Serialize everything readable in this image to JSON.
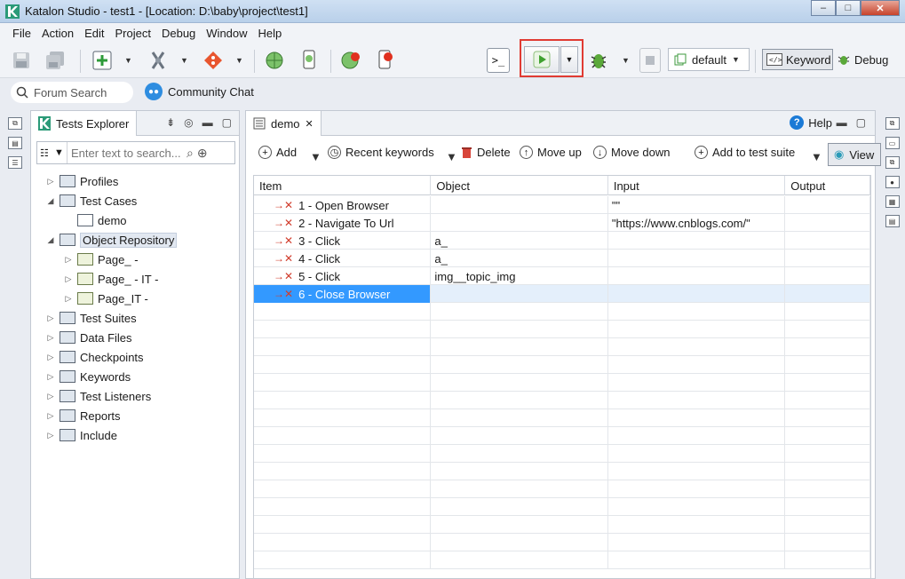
{
  "window": {
    "title": "Katalon Studio - test1 - [Location: D:\\baby\\project\\test1]",
    "controls": [
      "–",
      "□",
      "✕"
    ]
  },
  "menu": [
    "File",
    "Action",
    "Edit",
    "Project",
    "Debug",
    "Window",
    "Help"
  ],
  "toolbar": {
    "profile": "default",
    "keyword_label": "Keyword",
    "debug_label": "Debug"
  },
  "search": {
    "forum_placeholder": "Forum Search",
    "community_label": "Community Chat"
  },
  "explorer": {
    "tab_label": "Tests Explorer",
    "filter_placeholder": "Enter text to search...",
    "tree": [
      {
        "label": "Profiles",
        "depth": 0,
        "twisty": "▷",
        "icon": "profiles-icon"
      },
      {
        "label": "Test Cases",
        "depth": 0,
        "twisty": "◢",
        "icon": "test-cases-icon"
      },
      {
        "label": "demo",
        "depth": 1,
        "twisty": "",
        "icon": "test-case-icon"
      },
      {
        "label": "Object Repository",
        "depth": 0,
        "twisty": "◢",
        "icon": "object-repository-icon",
        "selected": true
      },
      {
        "label": "Page_ -",
        "depth": 1,
        "twisty": "▷",
        "icon": "folder-icon"
      },
      {
        "label": "Page_ - IT -",
        "depth": 1,
        "twisty": "▷",
        "icon": "folder-icon"
      },
      {
        "label": "Page_IT -",
        "depth": 1,
        "twisty": "▷",
        "icon": "folder-icon"
      },
      {
        "label": "Test Suites",
        "depth": 0,
        "twisty": "▷",
        "icon": "test-suites-icon"
      },
      {
        "label": "Data Files",
        "depth": 0,
        "twisty": "▷",
        "icon": "data-files-icon"
      },
      {
        "label": "Checkpoints",
        "depth": 0,
        "twisty": "▷",
        "icon": "checkpoints-icon"
      },
      {
        "label": "Keywords",
        "depth": 0,
        "twisty": "▷",
        "icon": "keywords-icon"
      },
      {
        "label": "Test Listeners",
        "depth": 0,
        "twisty": "▷",
        "icon": "test-listeners-icon"
      },
      {
        "label": "Reports",
        "depth": 0,
        "twisty": "▷",
        "icon": "reports-icon"
      },
      {
        "label": "Include",
        "depth": 0,
        "twisty": "▷",
        "icon": "include-icon"
      }
    ]
  },
  "editor": {
    "tab_label": "demo",
    "help_label": "Help",
    "actions": {
      "add": "Add",
      "recent": "Recent keywords",
      "delete": "Delete",
      "move_up": "Move up",
      "move_down": "Move down",
      "add_to_suite": "Add to test suite",
      "view": "View"
    },
    "columns": [
      "Item",
      "Object",
      "Input",
      "Output"
    ],
    "rows": [
      {
        "item": "1 - Open Browser",
        "object": "",
        "input": "\"\"",
        "output": ""
      },
      {
        "item": "2 - Navigate To Url",
        "object": "",
        "input": "\"https://www.cnblogs.com/\"",
        "output": ""
      },
      {
        "item": "3 - Click",
        "object": "a_",
        "input": "",
        "output": ""
      },
      {
        "item": "4 - Click",
        "object": "a_",
        "input": "",
        "output": ""
      },
      {
        "item": "5 - Click",
        "object": "img__topic_img",
        "input": "",
        "output": ""
      },
      {
        "item": "6 - Close Browser",
        "object": "",
        "input": "",
        "output": "",
        "selected": true
      }
    ]
  }
}
